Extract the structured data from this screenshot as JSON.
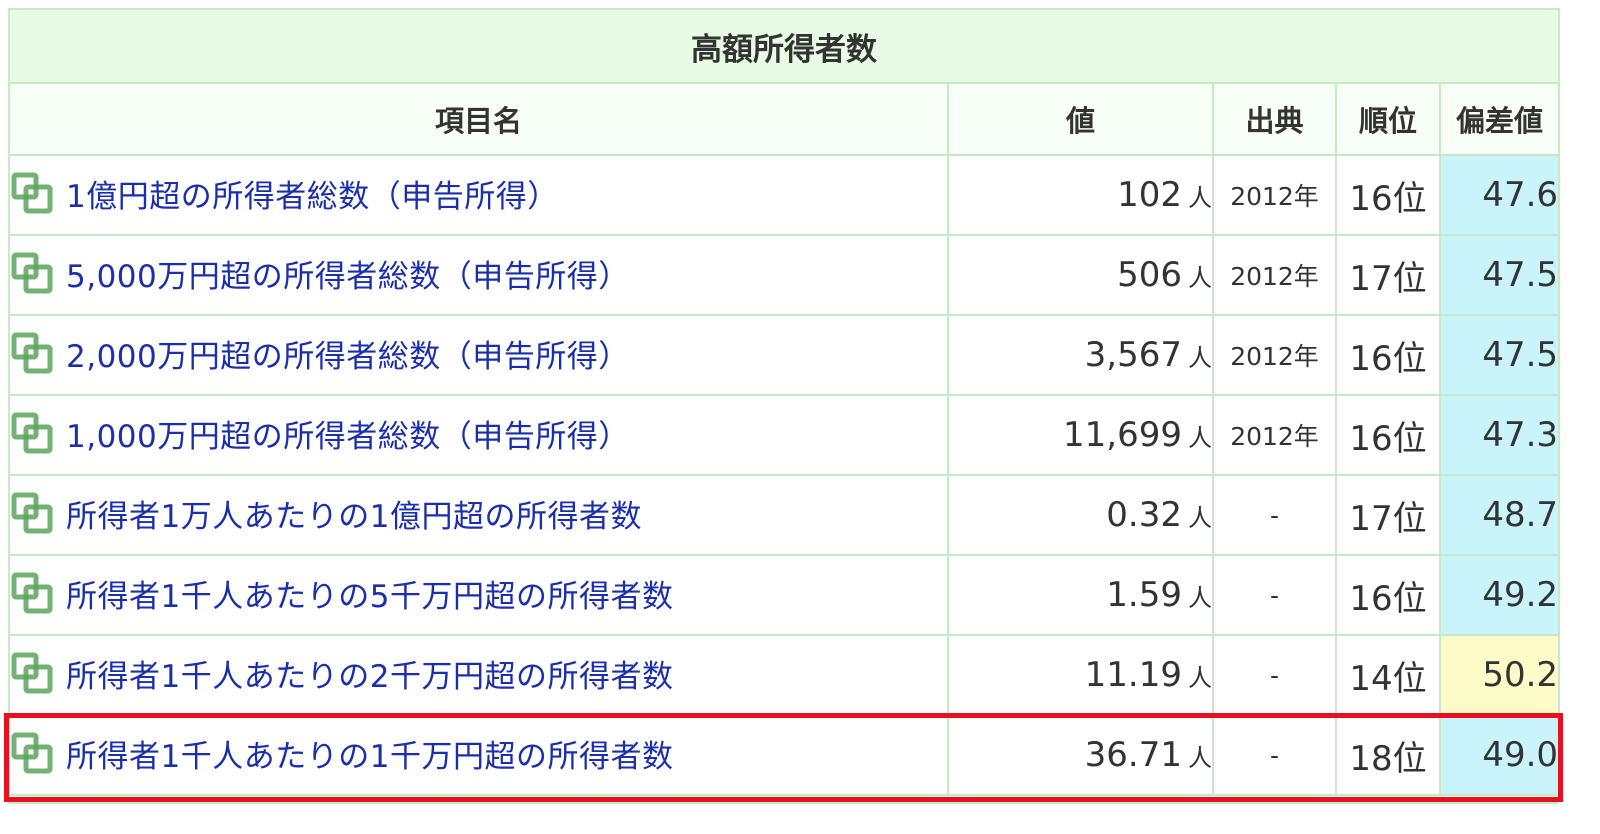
{
  "table": {
    "caption": "高額所得者数",
    "headers": {
      "name": "項目名",
      "value": "値",
      "source": "出典",
      "rank": "順位",
      "deviation": "偏差値"
    },
    "rows": [
      {
        "name": "1億円超の所得者総数（申告所得）",
        "value": "102",
        "unit": "人",
        "source": "2012年",
        "rank": "16位",
        "deviation": "47.6",
        "deviation_color": "blue",
        "icon": "copy-icon"
      },
      {
        "name": "5,000万円超の所得者総数（申告所得）",
        "value": "506",
        "unit": "人",
        "source": "2012年",
        "rank": "17位",
        "deviation": "47.5",
        "deviation_color": "blue",
        "icon": "copy-icon"
      },
      {
        "name": "2,000万円超の所得者総数（申告所得）",
        "value": "3,567",
        "unit": "人",
        "source": "2012年",
        "rank": "16位",
        "deviation": "47.5",
        "deviation_color": "blue",
        "icon": "copy-icon"
      },
      {
        "name": "1,000万円超の所得者総数（申告所得）",
        "value": "11,699",
        "unit": "人",
        "source": "2012年",
        "rank": "16位",
        "deviation": "47.3",
        "deviation_color": "blue",
        "icon": "copy-icon"
      },
      {
        "name": "所得者1万人あたりの1億円超の所得者数",
        "value": "0.32",
        "unit": "人",
        "source": "-",
        "rank": "17位",
        "deviation": "48.7",
        "deviation_color": "blue",
        "icon": "copy-icon"
      },
      {
        "name": "所得者1千人あたりの5千万円超の所得者数",
        "value": "1.59",
        "unit": "人",
        "source": "-",
        "rank": "16位",
        "deviation": "49.2",
        "deviation_color": "blue",
        "icon": "copy-icon"
      },
      {
        "name": "所得者1千人あたりの2千万円超の所得者数",
        "value": "11.19",
        "unit": "人",
        "source": "-",
        "rank": "14位",
        "deviation": "50.2",
        "deviation_color": "yellow",
        "icon": "copy-icon"
      },
      {
        "name": "所得者1千人あたりの1千万円超の所得者数",
        "value": "36.71",
        "unit": "人",
        "source": "-",
        "rank": "18位",
        "deviation": "49.0",
        "deviation_color": "blue",
        "icon": "copy-icon",
        "highlighted": true
      }
    ]
  },
  "colors": {
    "link": "#1a2fb0",
    "border": "#c6eac6",
    "caption_bg": "#e8fbe4",
    "deviation_blue": "#caf4fc",
    "deviation_yellow": "#fdfbc8",
    "highlight": "#e8101e",
    "icon_green": "#5aa55a"
  }
}
